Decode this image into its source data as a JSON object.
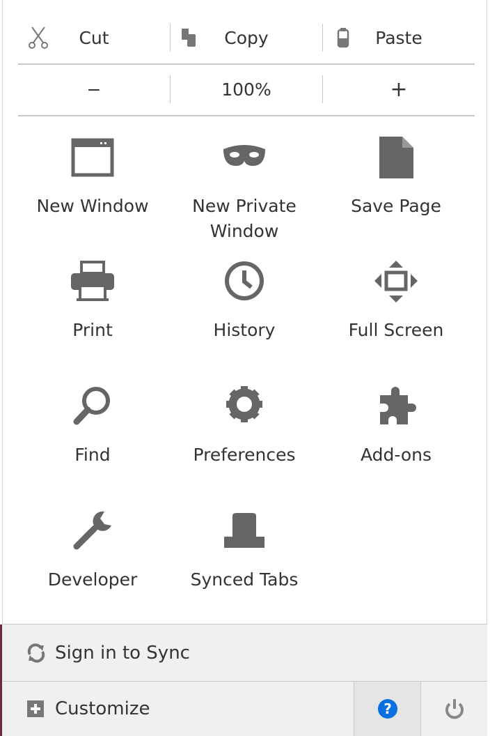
{
  "edit": {
    "cut": "Cut",
    "copy": "Copy",
    "paste": "Paste"
  },
  "zoom": {
    "minus": "−",
    "level": "100%",
    "plus": "+"
  },
  "items": [
    {
      "label": "New Window",
      "icon": "window-icon"
    },
    {
      "label": "New Private Window",
      "icon": "mask-icon"
    },
    {
      "label": "Save Page",
      "icon": "page-icon"
    },
    {
      "label": "Print",
      "icon": "printer-icon"
    },
    {
      "label": "History",
      "icon": "clock-icon"
    },
    {
      "label": "Full Screen",
      "icon": "fullscreen-icon"
    },
    {
      "label": "Find",
      "icon": "magnifier-icon"
    },
    {
      "label": "Preferences",
      "icon": "gear-icon"
    },
    {
      "label": "Add-ons",
      "icon": "puzzle-icon"
    },
    {
      "label": "Developer",
      "icon": "wrench-icon"
    },
    {
      "label": "Synced Tabs",
      "icon": "synced-tabs-icon"
    }
  ],
  "footer": {
    "sync": "Sign in to Sync",
    "customize": "Customize"
  },
  "colors": {
    "icon": "#666666",
    "help": "#0a6fe0",
    "footer_bg": "#f0f0f0"
  }
}
